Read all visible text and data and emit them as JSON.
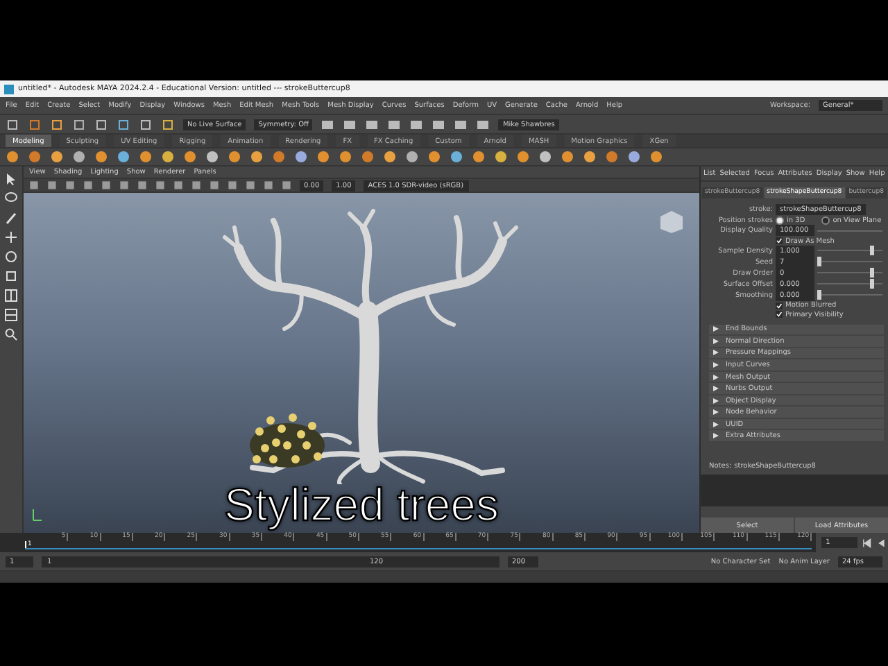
{
  "window": {
    "title": "untitled* - Autodesk MAYA 2024.2.4 - Educational Version: untitled  ---  strokeButtercup8"
  },
  "menu_bar": [
    "File",
    "Edit",
    "Create",
    "Select",
    "Modify",
    "Display",
    "Windows",
    "Mesh",
    "Edit Mesh",
    "Mesh Tools",
    "Mesh Display",
    "Curves",
    "Surfaces",
    "Deform",
    "UV",
    "Generate",
    "Cache",
    "Arnold",
    "Help"
  ],
  "workspace": {
    "label": "Workspace:",
    "value": "General*"
  },
  "status_line": {
    "live_surface": "No Live Surface",
    "symmetry": "Symmetry: Off",
    "user": "Mike Shawbres"
  },
  "shelf_tabs": [
    {
      "label": "Modeling",
      "selected": true
    },
    {
      "label": "Sculpting",
      "selected": false
    },
    {
      "label": "UV Editing",
      "selected": false
    },
    {
      "label": "Rigging",
      "selected": false
    },
    {
      "label": "Animation",
      "selected": false
    },
    {
      "label": "Rendering",
      "selected": false
    },
    {
      "label": "FX",
      "selected": false
    },
    {
      "label": "FX Caching",
      "selected": false
    },
    {
      "label": "Custom",
      "selected": false
    },
    {
      "label": "Arnold",
      "selected": false
    },
    {
      "label": "MASH",
      "selected": false
    },
    {
      "label": "Motion Graphics",
      "selected": false
    },
    {
      "label": "XGen",
      "selected": false
    }
  ],
  "viewport": {
    "menu": [
      "View",
      "Shading",
      "Lighting",
      "Show",
      "Renderer",
      "Panels"
    ],
    "exposure": "0.00",
    "gamma": "1.00",
    "color_space": "ACES 1.0 SDR-video (sRGB)",
    "caption": "Stylized trees"
  },
  "attribute_editor": {
    "menu": [
      "List",
      "Selected",
      "Focus",
      "Attributes",
      "Display",
      "Show",
      "Help"
    ],
    "tabs": [
      {
        "label": "strokeButtercup8",
        "selected": false
      },
      {
        "label": "strokeShapeButtercup8",
        "selected": true
      },
      {
        "label": "buttercup8",
        "selected": false
      }
    ],
    "stroke_field": {
      "label": "stroke:",
      "value": "strokeShapeButtercup8"
    },
    "position_strokes": {
      "label": "Position strokes",
      "options": [
        {
          "label": "in 3D",
          "selected": true
        },
        {
          "label": "on View Plane",
          "selected": false
        }
      ]
    },
    "attributes": [
      {
        "kind": "field",
        "label": "Display Quality",
        "value": "100.000"
      },
      {
        "kind": "checkbox",
        "label": "Draw As Mesh",
        "checked": true
      },
      {
        "kind": "slider",
        "label": "Sample Density",
        "value": "1.000",
        "level": 0.82
      },
      {
        "kind": "slider",
        "label": "Seed",
        "value": "7",
        "level": 0.03
      },
      {
        "kind": "slider",
        "label": "Draw Order",
        "value": "0",
        "level": 0.82
      },
      {
        "kind": "slider",
        "label": "Surface Offset",
        "value": "0.000",
        "level": 0.82
      },
      {
        "kind": "slider",
        "label": "Smoothing",
        "value": "0.000",
        "level": 0.03
      },
      {
        "kind": "checkbox",
        "label": "Motion Blurred",
        "checked": true
      },
      {
        "kind": "checkbox",
        "label": "Primary Visibility",
        "checked": true
      }
    ],
    "sections": [
      {
        "label": "End Bounds",
        "expanded": false
      },
      {
        "label": "Normal Direction",
        "expanded": false
      },
      {
        "label": "Pressure Mappings",
        "expanded": false
      },
      {
        "label": "Input Curves",
        "expanded": false
      },
      {
        "label": "Mesh Output",
        "expanded": false
      },
      {
        "label": "Nurbs Output",
        "expanded": false
      },
      {
        "label": "Object Display",
        "expanded": false
      },
      {
        "label": "Node Behavior",
        "expanded": false
      },
      {
        "label": "UUID",
        "expanded": false
      },
      {
        "label": "Extra Attributes",
        "expanded": false
      }
    ],
    "notes": {
      "label": "Notes:",
      "value": "strokeShapeButtercup8"
    },
    "buttons": [
      "Select",
      "Load Attributes"
    ]
  },
  "timeline": {
    "ticks": [
      "5",
      "10",
      "15",
      "20",
      "25",
      "30",
      "35",
      "40",
      "45",
      "50",
      "55",
      "60",
      "65",
      "70",
      "75",
      "80",
      "85",
      "90",
      "95",
      "100",
      "105",
      "110",
      "115",
      "120"
    ],
    "current_frame_label": "1",
    "level": 0,
    "current_frame": "1"
  },
  "range_slider": {
    "start": "1",
    "range_start": "1",
    "range_end": "120",
    "end": "200",
    "character_set": "No Character Set",
    "anim_layer": "No Anim Layer",
    "fps": "24 fps"
  }
}
